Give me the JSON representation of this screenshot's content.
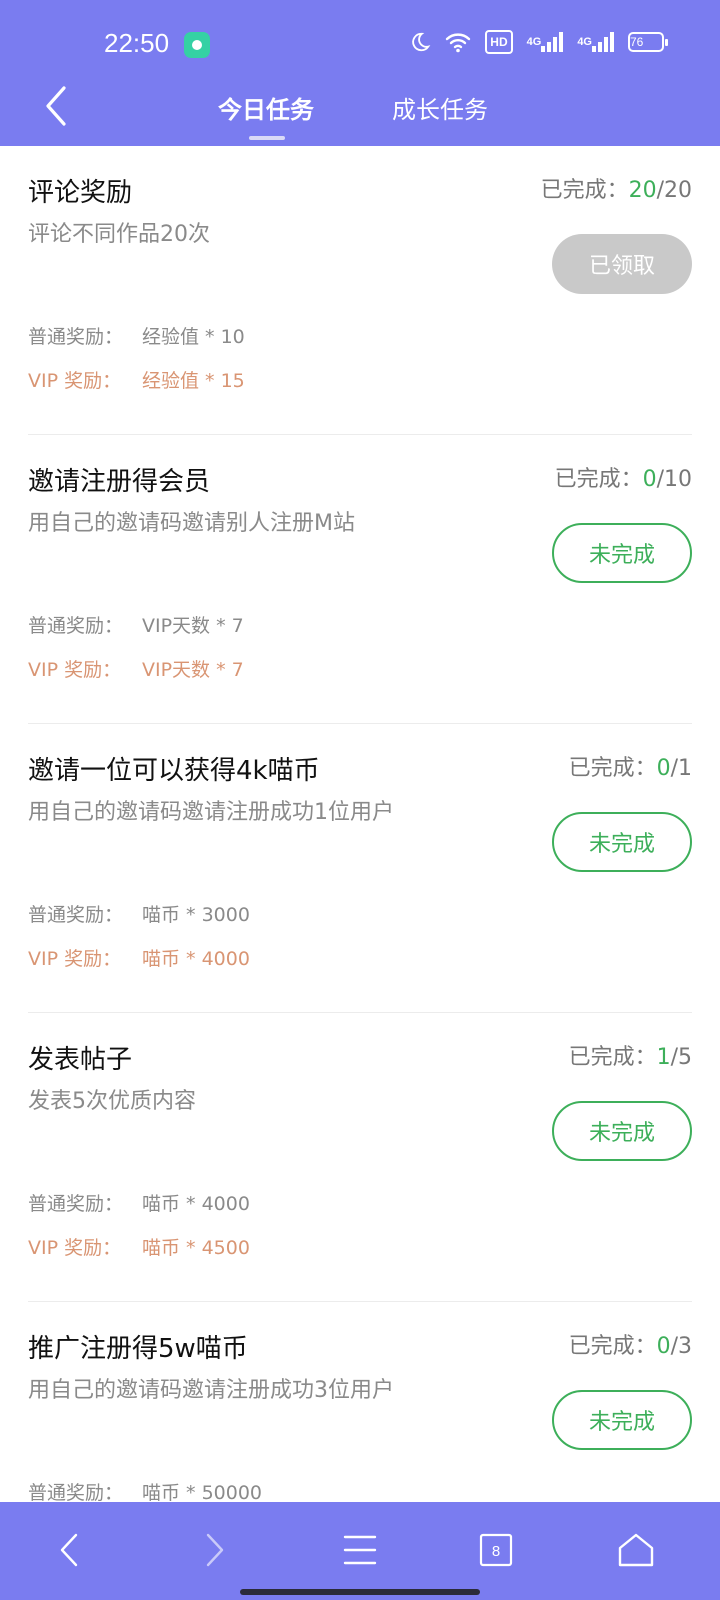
{
  "status_bar": {
    "time": "22:50",
    "hd_label": "HD",
    "network_1": "4G",
    "network_2": "4G",
    "battery": "76"
  },
  "header": {
    "tabs": [
      {
        "label": "今日任务",
        "active": true
      },
      {
        "label": "成长任务",
        "active": false
      }
    ]
  },
  "labels": {
    "progress_prefix": "已完成：",
    "normal_reward": "普通奖励：",
    "vip_reward": "VIP 奖励："
  },
  "tasks": [
    {
      "title": "评论奖励",
      "description": "评论不同作品20次",
      "done": "20",
      "total": "/20",
      "button": "已领取",
      "normal_reward": "经验值 * 10",
      "vip_reward": "经验值 * 15"
    },
    {
      "title": "邀请注册得会员",
      "description": "用自己的邀请码邀请别人注册M站",
      "done": "0",
      "total": "/10",
      "button": "未完成",
      "normal_reward": "VIP天数 * 7",
      "vip_reward": "VIP天数 * 7"
    },
    {
      "title": "邀请一位可以获得4k喵币",
      "description": "用自己的邀请码邀请注册成功1位用户",
      "done": "0",
      "total": "/1",
      "button": "未完成",
      "normal_reward": "喵币 * 3000",
      "vip_reward": "喵币 * 4000"
    },
    {
      "title": "发表帖子",
      "description": "发表5次优质内容",
      "done": "1",
      "total": "/5",
      "button": "未完成",
      "normal_reward": "喵币 * 4000",
      "vip_reward": "喵币 * 4500"
    },
    {
      "title": "推广注册得5w喵币",
      "description": "用自己的邀请码邀请注册成功3位用户",
      "done": "0",
      "total": "/3",
      "button": "未完成",
      "normal_reward": "喵币 * 50000",
      "vip_reward": ""
    }
  ],
  "bottom_nav": {
    "tab_count": "8"
  },
  "colors": {
    "header": "#7a7cf0",
    "accent_green": "#3daf5a",
    "vip": "#d99573",
    "claimed": "#c9c9c9"
  }
}
